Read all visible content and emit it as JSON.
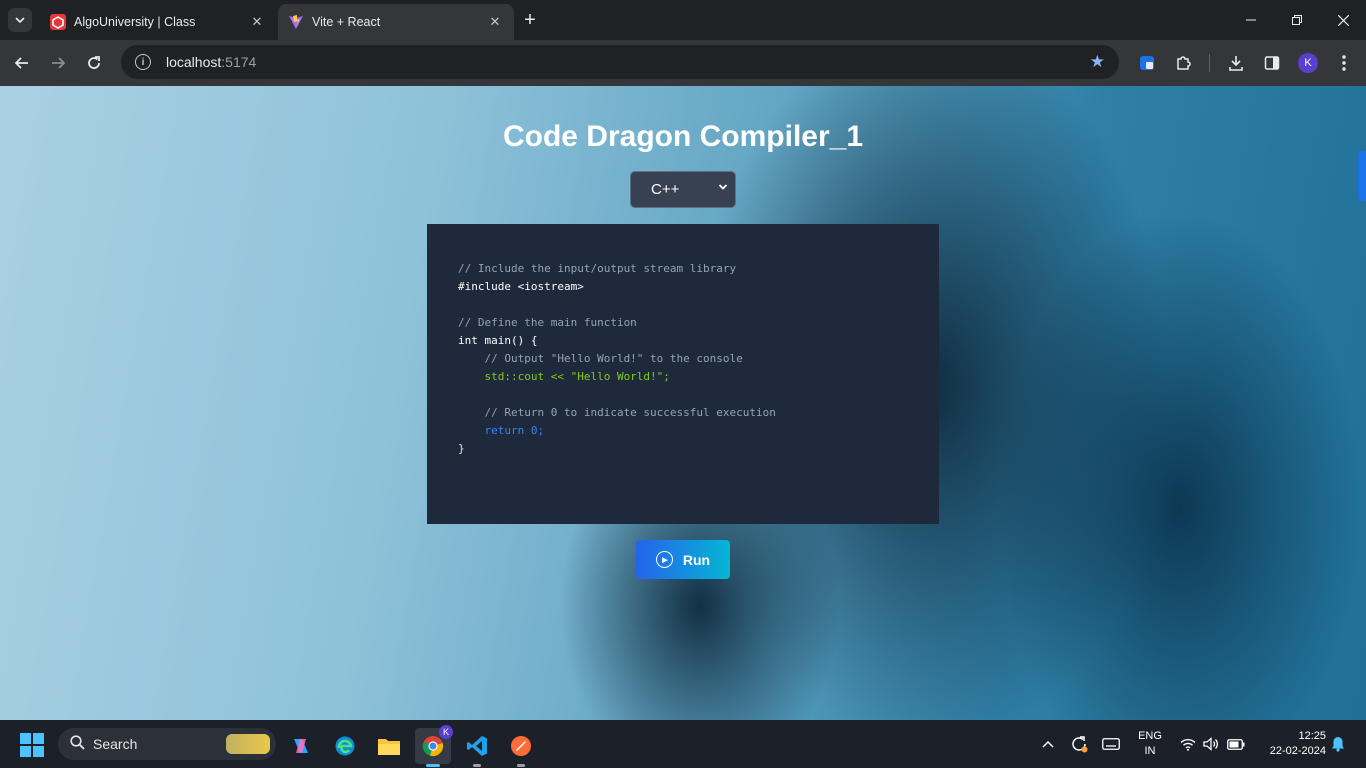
{
  "browser": {
    "tabs": [
      {
        "title": "AlgoUniversity | Class",
        "favicon": "algouniversity-icon",
        "active": false
      },
      {
        "title": "Vite + React",
        "favicon": "vite-icon",
        "active": true
      }
    ],
    "url_host": "localhost",
    "url_port": ":5174",
    "profile_initial": "K"
  },
  "page": {
    "title": "Code Dragon Compiler_1",
    "language": "C++",
    "code": [
      "// Include the input/output stream library",
      "#include <iostream>",
      "",
      "// Define the main function",
      "int main() {",
      "    // Output \"Hello World!\" to the console",
      "    std::cout << \"Hello World!\";",
      "",
      "    // Return 0 to indicate successful execution",
      "    return 0;",
      "}"
    ],
    "run_label": "Run"
  },
  "taskbar": {
    "search_label": "Search",
    "lang_top": "ENG",
    "lang_bottom": "IN",
    "time": "12:25",
    "date": "22-02-2024",
    "chrome_badge": "K"
  },
  "colors": {
    "accent": "#1a73e8",
    "editor_bg": "#1e293b",
    "run_gradient_start": "#2563eb",
    "run_gradient_end": "#06b6d4"
  }
}
